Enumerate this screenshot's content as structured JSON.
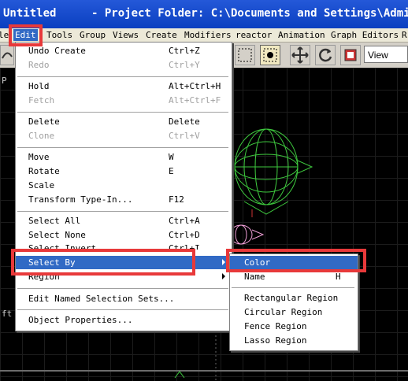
{
  "title": {
    "file": "Untitled",
    "project": "- Project Folder: C:\\Documents and Settings\\Admini"
  },
  "menubar": {
    "edge_left": "le",
    "items": [
      "Edit",
      "Tools",
      "Group",
      "Views",
      "Create",
      "Modifiers",
      "reactor",
      "Animation",
      "Graph Editors"
    ],
    "edge_right": "R"
  },
  "toolbar": {
    "view_select": "View"
  },
  "viewport": {
    "label_top": "P",
    "label_mid": "ft"
  },
  "edit_menu": [
    {
      "label": "Undo Create",
      "shortcut": "Ctrl+Z",
      "enabled": true
    },
    {
      "label": "Redo",
      "shortcut": "Ctrl+Y",
      "enabled": false
    },
    {
      "label": "Hold",
      "shortcut": "Alt+Ctrl+H",
      "enabled": true
    },
    {
      "label": "Fetch",
      "shortcut": "Alt+Ctrl+F",
      "enabled": false
    },
    {
      "label": "Delete",
      "shortcut": "Delete",
      "enabled": true
    },
    {
      "label": "Clone",
      "shortcut": "Ctrl+V",
      "enabled": false
    },
    {
      "label": "Move",
      "shortcut": "W",
      "enabled": true
    },
    {
      "label": "Rotate",
      "shortcut": "E",
      "enabled": true
    },
    {
      "label": "Scale",
      "shortcut": "",
      "enabled": true
    },
    {
      "label": "Transform Type-In...",
      "shortcut": "F12",
      "enabled": true
    },
    {
      "label": "Select All",
      "shortcut": "Ctrl+A",
      "enabled": true
    },
    {
      "label": "Select None",
      "shortcut": "Ctrl+D",
      "enabled": true
    },
    {
      "label": "Select Invert",
      "shortcut": "Ctrl+I",
      "enabled": true
    },
    {
      "label": "Select By",
      "shortcut": "",
      "enabled": true,
      "submenu": true,
      "highlighted": true
    },
    {
      "label": "Region",
      "shortcut": "",
      "enabled": true,
      "submenu": true
    },
    {
      "label": "Edit Named Selection Sets...",
      "shortcut": "",
      "enabled": true
    },
    {
      "label": "Object Properties...",
      "shortcut": "",
      "enabled": true
    }
  ],
  "select_by_submenu": [
    {
      "label": "Color",
      "shortcut": "",
      "highlighted": true
    },
    {
      "label": "Name",
      "shortcut": "H"
    },
    {
      "label": "Rectangular Region",
      "shortcut": ""
    },
    {
      "label": "Circular Region",
      "shortcut": ""
    },
    {
      "label": "Fence Region",
      "shortcut": ""
    },
    {
      "label": "Lasso Region",
      "shortcut": ""
    }
  ],
  "colors": {
    "highlight": "#316ac5",
    "annotation": "#e8393a",
    "title_bar": "#0a3fc0",
    "wire_green": "#3ec83e",
    "wire_pink": "#f0a0d8"
  }
}
